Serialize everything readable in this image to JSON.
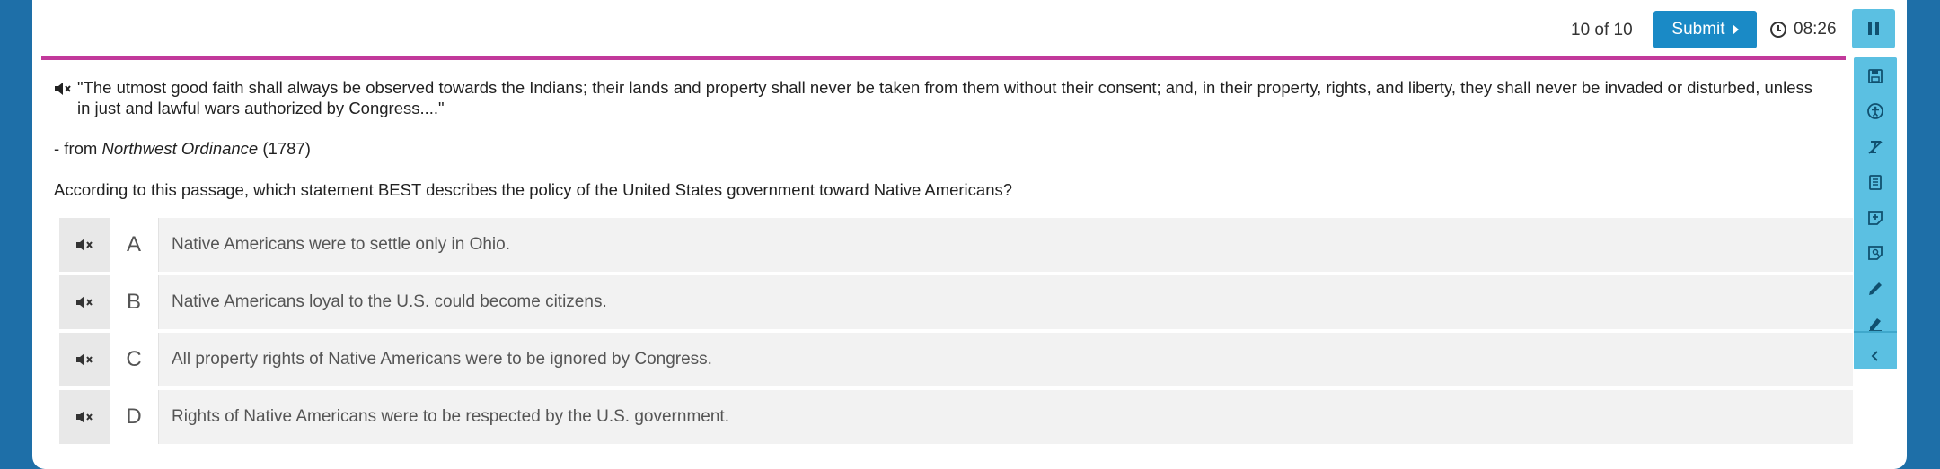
{
  "header": {
    "progress": "10 of 10",
    "submit_label": "Submit",
    "timer": "08:26"
  },
  "passage": {
    "quote": "\"The utmost good faith shall always be observed towards the Indians; their lands and property shall never be taken from them without their consent; and, in their property, rights, and liberty, they shall never be invaded or disturbed, unless in just and lawful wars authorized by Congress....\"",
    "source_prefix": "- from ",
    "source_title": "Northwest Ordinance",
    "source_year": " (1787)",
    "question": "According to this passage, which statement BEST describes the policy of the United States government toward Native Americans?"
  },
  "choices": [
    {
      "letter": "A",
      "text": "Native Americans were to settle only in Ohio."
    },
    {
      "letter": "B",
      "text": "Native Americans loyal to the U.S. could become citizens."
    },
    {
      "letter": "C",
      "text": "All property rights of Native Americans were to be ignored by Congress."
    },
    {
      "letter": "D",
      "text": "Rights of Native Americans were to be respected by the U.S. government."
    }
  ],
  "sidebar_tools": [
    "save-icon",
    "accessibility-icon",
    "clear-format-icon",
    "notepad-icon",
    "add-note-icon",
    "review-note-icon",
    "pencil-icon",
    "highlighter-icon",
    "collapse-chevron-icon"
  ],
  "colors": {
    "background": "#1e6fa8",
    "accent": "#1a8ac6",
    "sidebar": "#5bc0e2",
    "divider": "#c2399b"
  }
}
